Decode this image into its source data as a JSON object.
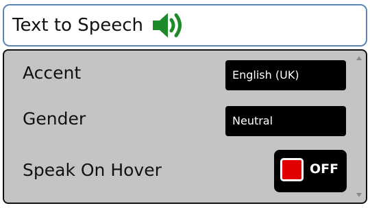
{
  "header": {
    "title": "Text to Speech",
    "icon": "speaker-icon",
    "icon_color": "#1f8a2a",
    "border_color": "#5b86b3"
  },
  "settings": {
    "accent": {
      "label": "Accent",
      "value": "English (UK)"
    },
    "gender": {
      "label": "Gender",
      "value": "Neutral"
    },
    "speak_on_hover": {
      "label": "Speak On Hover",
      "state": "OFF",
      "indicator_color": "#e00000"
    }
  },
  "panel": {
    "background": "#c4c4c4"
  }
}
